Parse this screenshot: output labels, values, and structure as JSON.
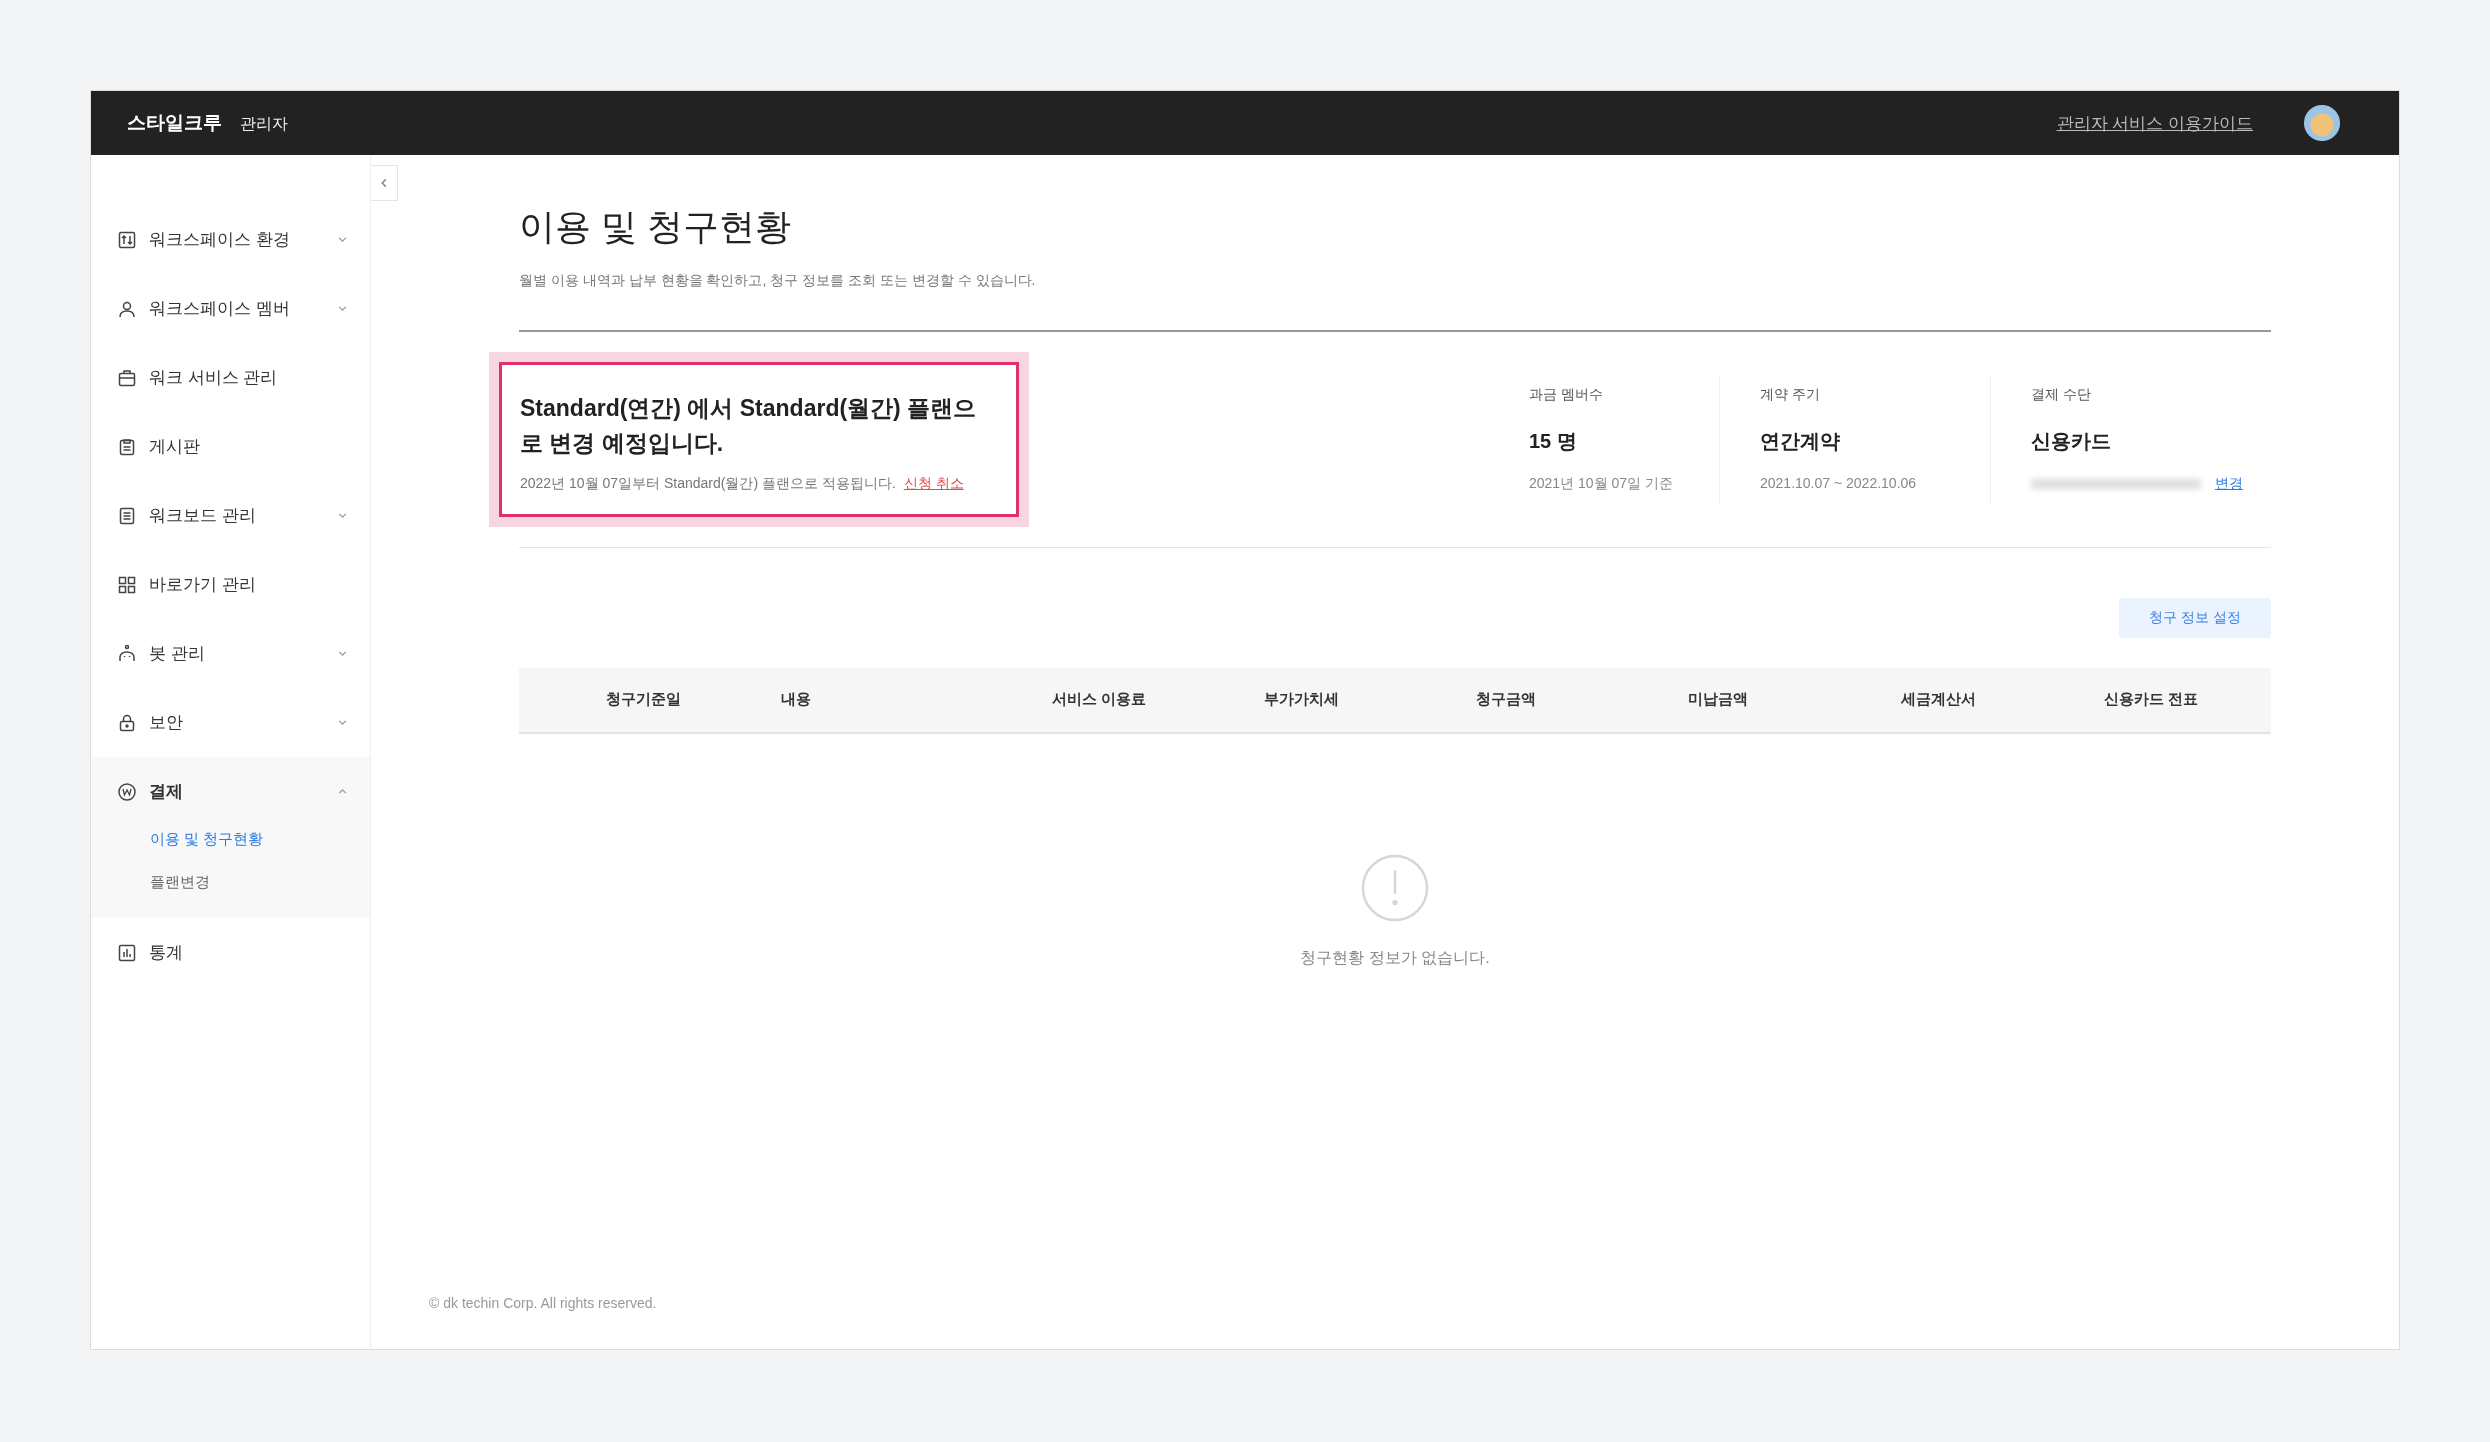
{
  "header": {
    "brand": "스타일크루",
    "role": "관리자",
    "guide_link": "관리자 서비스 이용가이드"
  },
  "sidebar": {
    "items": [
      {
        "label": "워크스페이스 환경",
        "kind": "group",
        "expanded": false
      },
      {
        "label": "워크스페이스 멤버",
        "kind": "group",
        "expanded": false
      },
      {
        "label": "워크 서비스 관리",
        "kind": "link"
      },
      {
        "label": "게시판",
        "kind": "link"
      },
      {
        "label": "워크보드 관리",
        "kind": "group",
        "expanded": false
      },
      {
        "label": "바로가기 관리",
        "kind": "link"
      },
      {
        "label": "봇 관리",
        "kind": "group",
        "expanded": false
      },
      {
        "label": "보안",
        "kind": "group",
        "expanded": false
      },
      {
        "label": "결제",
        "kind": "group",
        "expanded": true,
        "children": [
          {
            "label": "이용 및 청구현황",
            "selected": true
          },
          {
            "label": "플랜변경",
            "selected": false
          }
        ]
      },
      {
        "label": "통계",
        "kind": "link"
      }
    ]
  },
  "page": {
    "title": "이용 및 청구현황",
    "subtitle": "월별 이용 내역과 납부 현황을 확인하고, 청구 정보를 조회 또는 변경할 수 있습니다."
  },
  "plan_notice": {
    "headline": "Standard(연간) 에서 Standard(월간) 플랜으로 변경 예정입니다.",
    "detail": "2022년 10월 07일부터 Standard(월간) 플랜으로 적용됩니다.",
    "cancel_link": "신청 취소",
    "highlighted": true
  },
  "stats": [
    {
      "label": "과금 멤버수",
      "value": "15 명",
      "note": "2021년 10월 07일 기준"
    },
    {
      "label": "계약 주기",
      "value": "연간계약",
      "note": "2021.10.07 ~ 2022.10.06"
    },
    {
      "label": "결제 수단",
      "value": "신용카드",
      "note_masked": true,
      "link": "변경"
    }
  ],
  "billing_settings_button": "청구 정보 설정",
  "table": {
    "columns": [
      "청구기준일",
      "내용",
      "서비스 이용료",
      "부가가치세",
      "청구금액",
      "미납금액",
      "세금계산서",
      "신용카드 전표"
    ],
    "empty_message": "청구현황 정보가 없습니다."
  },
  "footer": "© dk techin Corp. All rights reserved."
}
